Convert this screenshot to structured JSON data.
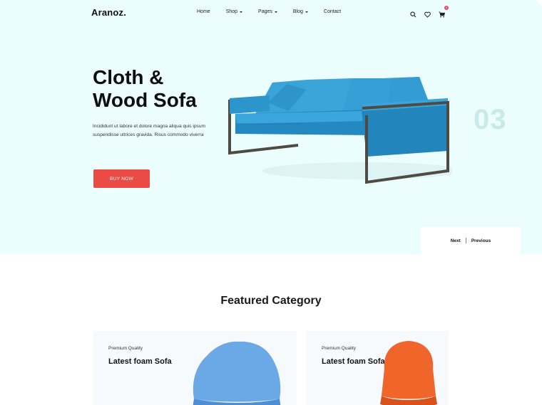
{
  "brand": {
    "logo": "Aranoz."
  },
  "nav": {
    "items": [
      {
        "label": "Home",
        "dropdown": false
      },
      {
        "label": "Shop",
        "dropdown": true
      },
      {
        "label": "Pages",
        "dropdown": true
      },
      {
        "label": "Blog",
        "dropdown": true
      },
      {
        "label": "Contact",
        "dropdown": false
      }
    ],
    "icons": [
      "search-icon",
      "heart-icon",
      "cart-icon"
    ],
    "cart_badge": "0"
  },
  "hero": {
    "title_line1": "Cloth &",
    "title_line2": "Wood Sofa",
    "description": "Incididunt ut labore et dolore magna aliqua quis ipsum suspendisse ultrices gravida. Risus commodo viverra",
    "button": "BUY NOW",
    "slide_number": "03",
    "next": "Next",
    "previous": "Previous"
  },
  "featured": {
    "title": "Featured Category",
    "cards": [
      {
        "subtitle": "Premium Quality",
        "title": "Latest foam Sofa",
        "image": "blue-chair"
      },
      {
        "subtitle": "Premium Quality",
        "title": "Latest foam Sofa",
        "image": "orange-chair"
      }
    ]
  },
  "colors": {
    "hero_bg": "#ecfdfd",
    "accent": "#ea4b45",
    "sofa": "#2b9ad0",
    "slide_number": "#c8eaea",
    "blue_chair": "#6aa8e6",
    "orange_chair": "#f0652a"
  }
}
